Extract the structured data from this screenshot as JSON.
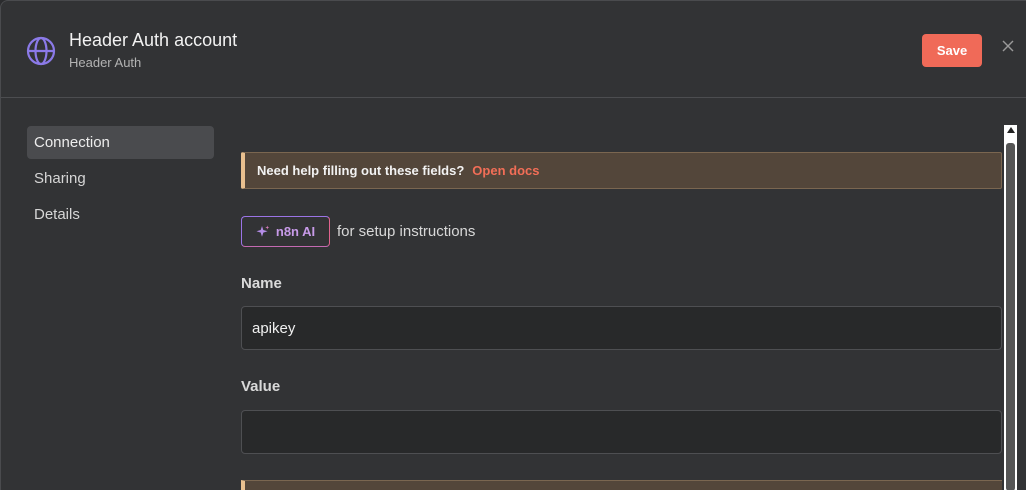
{
  "header": {
    "title": "Header Auth account",
    "subtitle": "Header Auth",
    "icon": "globe-icon",
    "save_label": "Save",
    "accent_color": "#f06a58"
  },
  "sidebar": {
    "items": [
      {
        "label": "Connection",
        "active": true
      },
      {
        "label": "Sharing",
        "active": false
      },
      {
        "label": "Details",
        "active": false
      }
    ]
  },
  "content": {
    "notice_text": "Need help filling out these fields?",
    "notice_link": "Open docs",
    "ai_button_label": "n8n AI",
    "ai_caption": "for setup instructions",
    "fields": [
      {
        "label": "Name",
        "value": "apikey"
      },
      {
        "label": "Value",
        "value": ""
      }
    ]
  }
}
